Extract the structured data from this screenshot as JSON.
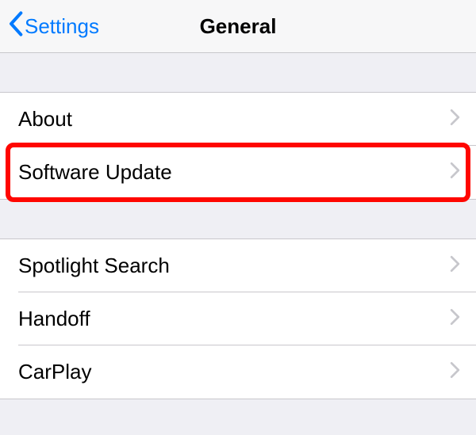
{
  "nav": {
    "back_label": "Settings",
    "title": "General"
  },
  "group1": {
    "items": [
      {
        "label": "About"
      },
      {
        "label": "Software Update"
      }
    ]
  },
  "group2": {
    "items": [
      {
        "label": "Spotlight Search"
      },
      {
        "label": "Handoff"
      },
      {
        "label": "CarPlay"
      }
    ]
  }
}
